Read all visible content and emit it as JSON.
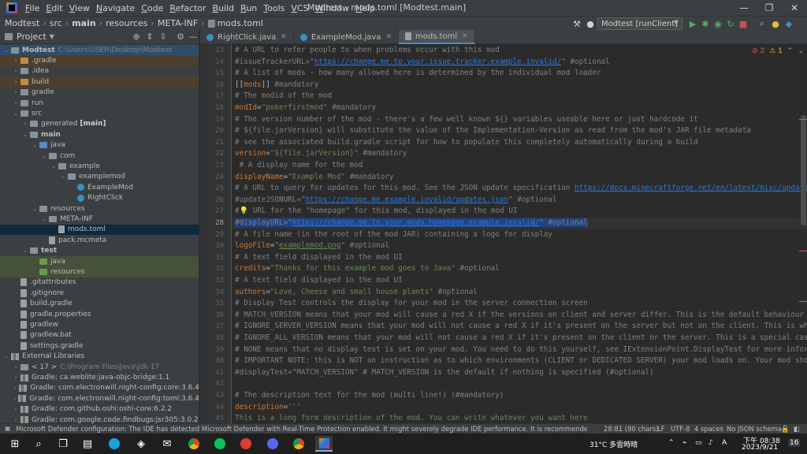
{
  "menu": {
    "items": [
      "File",
      "Edit",
      "View",
      "Navigate",
      "Code",
      "Refactor",
      "Build",
      "Run",
      "Tools",
      "VCS",
      "Window",
      "Help"
    ],
    "window_title": "Modtest - mods.toml [Modtest.main]"
  },
  "window_controls": {
    "minimize": "—",
    "restore": "❐",
    "close": "✕"
  },
  "breadcrumb": [
    "Modtest",
    "src",
    "main",
    "resources",
    "META-INF",
    "mods.toml"
  ],
  "run_config": {
    "label": "Modtest [runClient]"
  },
  "project_panel": {
    "title": "Project",
    "rows": [
      {
        "label": "Modtest",
        "path": "C:\\Users\\USER\\Desktop\\Modtest",
        "bold": true,
        "depth": 0,
        "chev": "⌄",
        "icon": "folder",
        "style": "selstrong"
      },
      {
        "label": ".gradle",
        "depth": 1,
        "chev": "›",
        "icon": "folder-orange",
        "style": "excl"
      },
      {
        "label": ".idea",
        "depth": 1,
        "chev": "›",
        "icon": "folder",
        "style": ""
      },
      {
        "label": "build",
        "depth": 1,
        "chev": "›",
        "icon": "folder-orange",
        "style": "excl"
      },
      {
        "label": "gradle",
        "depth": 1,
        "chev": "›",
        "icon": "folder",
        "style": ""
      },
      {
        "label": "run",
        "depth": 1,
        "chev": "›",
        "icon": "folder",
        "style": ""
      },
      {
        "label": "src",
        "depth": 1,
        "chev": "⌄",
        "icon": "folder",
        "style": ""
      },
      {
        "label": "generated [main]",
        "depth": 2,
        "chev": "›",
        "icon": "folder",
        "style": "",
        "boldpart": "[main]"
      },
      {
        "label": "main",
        "depth": 2,
        "chev": "⌄",
        "icon": "folder",
        "style": "",
        "bold": true
      },
      {
        "label": "java",
        "depth": 3,
        "chev": "⌄",
        "icon": "folder-blue",
        "style": ""
      },
      {
        "label": "com",
        "depth": 4,
        "chev": "⌄",
        "icon": "folder",
        "style": ""
      },
      {
        "label": "example",
        "depth": 5,
        "chev": "⌄",
        "icon": "folder",
        "style": ""
      },
      {
        "label": "examplemod",
        "depth": 6,
        "chev": "⌄",
        "icon": "folder",
        "style": ""
      },
      {
        "label": "ExampleMod",
        "depth": 7,
        "chev": "",
        "icon": "class",
        "style": ""
      },
      {
        "label": "RightClick",
        "depth": 7,
        "chev": "",
        "icon": "class",
        "style": ""
      },
      {
        "label": "resources",
        "depth": 3,
        "chev": "⌄",
        "icon": "folder",
        "style": ""
      },
      {
        "label": "META-INF",
        "depth": 4,
        "chev": "⌄",
        "icon": "folder",
        "style": ""
      },
      {
        "label": "mods.toml",
        "depth": 5,
        "chev": "",
        "icon": "file",
        "style": "sel"
      },
      {
        "label": "pack.mcmeta",
        "depth": 4,
        "chev": "",
        "icon": "file",
        "style": ""
      },
      {
        "label": "test",
        "depth": 2,
        "chev": "⌄",
        "icon": "folder",
        "style": "",
        "bold": true
      },
      {
        "label": "java",
        "depth": 3,
        "chev": "",
        "icon": "folder-green",
        "style": "test"
      },
      {
        "label": "resources",
        "depth": 3,
        "chev": "",
        "icon": "folder-green",
        "style": "test"
      },
      {
        "label": ".gitattributes",
        "depth": 1,
        "chev": "",
        "icon": "file",
        "style": ""
      },
      {
        "label": ".gitignore",
        "depth": 1,
        "chev": "",
        "icon": "file",
        "style": ""
      },
      {
        "label": "build.gradle",
        "depth": 1,
        "chev": "",
        "icon": "file",
        "style": ""
      },
      {
        "label": "gradle.properties",
        "depth": 1,
        "chev": "",
        "icon": "file",
        "style": ""
      },
      {
        "label": "gradlew",
        "depth": 1,
        "chev": "",
        "icon": "file",
        "style": ""
      },
      {
        "label": "gradlew.bat",
        "depth": 1,
        "chev": "",
        "icon": "file",
        "style": ""
      },
      {
        "label": "settings.gradle",
        "depth": 1,
        "chev": "",
        "icon": "file",
        "style": ""
      },
      {
        "label": "External Libraries",
        "depth": 0,
        "chev": "⌄",
        "icon": "lib",
        "style": ""
      },
      {
        "label": "< 17 >",
        "path": "C:\\Program Files\\Java\\jdk-17",
        "depth": 1,
        "chev": "›",
        "icon": "folder",
        "style": ""
      },
      {
        "label": "Gradle: ca.weblite:java-objc-bridge:1.1",
        "depth": 1,
        "chev": "›",
        "icon": "lib",
        "style": ""
      },
      {
        "label": "Gradle: com.electronwill.night-config:core:3.6.4",
        "depth": 1,
        "chev": "›",
        "icon": "lib",
        "style": ""
      },
      {
        "label": "Gradle: com.electronwill.night-config:toml:3.6.4",
        "depth": 1,
        "chev": "›",
        "icon": "lib",
        "style": ""
      },
      {
        "label": "Gradle: com.github.oshi:oshi-core:6.2.2",
        "depth": 1,
        "chev": "›",
        "icon": "lib",
        "style": ""
      },
      {
        "label": "Gradle: com.google.code.findbugs:jsr305:3.0.2",
        "depth": 1,
        "chev": "›",
        "icon": "lib",
        "style": ""
      }
    ]
  },
  "tabs": [
    {
      "label": "RightClick.java",
      "icon": "class",
      "active": false
    },
    {
      "label": "ExampleMod.java",
      "icon": "class",
      "active": false
    },
    {
      "label": "mods.toml",
      "icon": "file",
      "active": true
    }
  ],
  "editor": {
    "inspection": {
      "errors": "2",
      "warnings": "1"
    },
    "current_line": 28,
    "lines": [
      {
        "n": 13,
        "t": "# A URL to refer people to when problems occur with this mod"
      },
      {
        "n": 14,
        "t": "#issueTrackerURL=\"https://change.me.to.your.issue.tracker.example.invalid/\" #optional"
      },
      {
        "n": 15,
        "t": "# A list of mods - how many allowed here is determined by the individual mod loader"
      },
      {
        "n": 16,
        "t": "[[mods]] #mandatory"
      },
      {
        "n": 17,
        "t": "# The modid of the mod"
      },
      {
        "n": 18,
        "t": "modId=\"pokerfirstmod\" #mandatory"
      },
      {
        "n": 19,
        "t": "# The version number of the mod - there's a few well known ${} variables useable here or just hardcode it"
      },
      {
        "n": 20,
        "t": "# ${file.jarVersion} will substitute the value of the Implementation-Version as read from the mod's JAR file metadata"
      },
      {
        "n": 21,
        "t": "# see the associated build.gradle script for how to populate this completely automatically during a build"
      },
      {
        "n": 22,
        "t": "version=\"${file.jarVersion}\" #mandatory"
      },
      {
        "n": 23,
        "t": " # A display name for the mod"
      },
      {
        "n": 24,
        "t": "displayName=\"Example Mod\" #mandatory"
      },
      {
        "n": 25,
        "t": "# A URL to query for updates for this mod. See the JSON update specification https://docs.minecraftforge.net/en/latest/misc/updatechecker/"
      },
      {
        "n": 26,
        "t": "#updateJSONURL=\"https://change.me.example.invalid/updates.json\" #optional"
      },
      {
        "n": 27,
        "t": "#💡 URL for the \"homepage\" for this mod, displayed in the mod UI"
      },
      {
        "n": 28,
        "t": "#displayURL=\"https://change.me.to.your.mods.homepage.example.invalid/\" #optional"
      },
      {
        "n": 29,
        "t": "# A file name (in the root of the mod JAR) containing a logo for display"
      },
      {
        "n": 30,
        "t": "logoFile=\"examplemod.png\" #optional"
      },
      {
        "n": 31,
        "t": "# A text field displayed in the mod UI"
      },
      {
        "n": 32,
        "t": "credits=\"Thanks for this example mod goes to Java\" #optional"
      },
      {
        "n": 33,
        "t": "# A text field displayed in the mod UI"
      },
      {
        "n": 34,
        "t": "authors=\"Love, Cheese and small house plants\" #optional"
      },
      {
        "n": 35,
        "t": "# Display Test controls the display for your mod in the server connection screen"
      },
      {
        "n": 36,
        "t": "# MATCH_VERSION means that your mod will cause a red X if the versions on client and server differ. This is the default behaviour and sho"
      },
      {
        "n": 37,
        "t": "# IGNORE_SERVER_VERSION means that your mod will not cause a red X if it's present on the server but not on the client. This is what you"
      },
      {
        "n": 38,
        "t": "# IGNORE_ALL_VERSION means that your mod will not cause a red X if it's present on the client or the server. This is a special case and"
      },
      {
        "n": 39,
        "t": "# NONE means that no display test is set on your mod. You need to do this yourself, see IExtensionPoint.DisplayTest for more information"
      },
      {
        "n": 40,
        "t": "# IMPORTANT NOTE: this is NOT an instruction as to which environments (CLIENT or DEDICATED SERVER) your mod loads on. Your mod should lo"
      },
      {
        "n": 41,
        "t": "#displayTest=\"MATCH_VERSION\" # MATCH_VERSION is the default if nothing is specified (#optional)"
      },
      {
        "n": 42,
        "t": ""
      },
      {
        "n": 43,
        "t": "# The description text for the mod (multi line!) (#mandatory)"
      },
      {
        "n": 44,
        "t": "description='''"
      },
      {
        "n": 45,
        "t": "This is a long form description of the mod. You can write whatever you want here"
      }
    ]
  },
  "statusbar": {
    "message": "Microsoft Defender configuration: The IDE has detected Microsoft Defender with Real-Time Protection enabled. It might severely degrade IDE performance. It is recommended to a... (10 minutes a",
    "position": "28:81 (80 chars)",
    "line_sep": "LF",
    "encoding": "UTF-8",
    "indent": "4 spaces",
    "schema": "No JSON schema"
  },
  "taskbar": {
    "weather": "31°C  多雲時晴",
    "time": "下午 08:38",
    "date": "2023/9/21",
    "notifications": "16"
  },
  "colors": {
    "accent": "#4a88c7",
    "error": "#e05555",
    "warning": "#e8b94a",
    "string": "#6a8759",
    "keyword": "#cc7832",
    "comment": "#808080"
  }
}
